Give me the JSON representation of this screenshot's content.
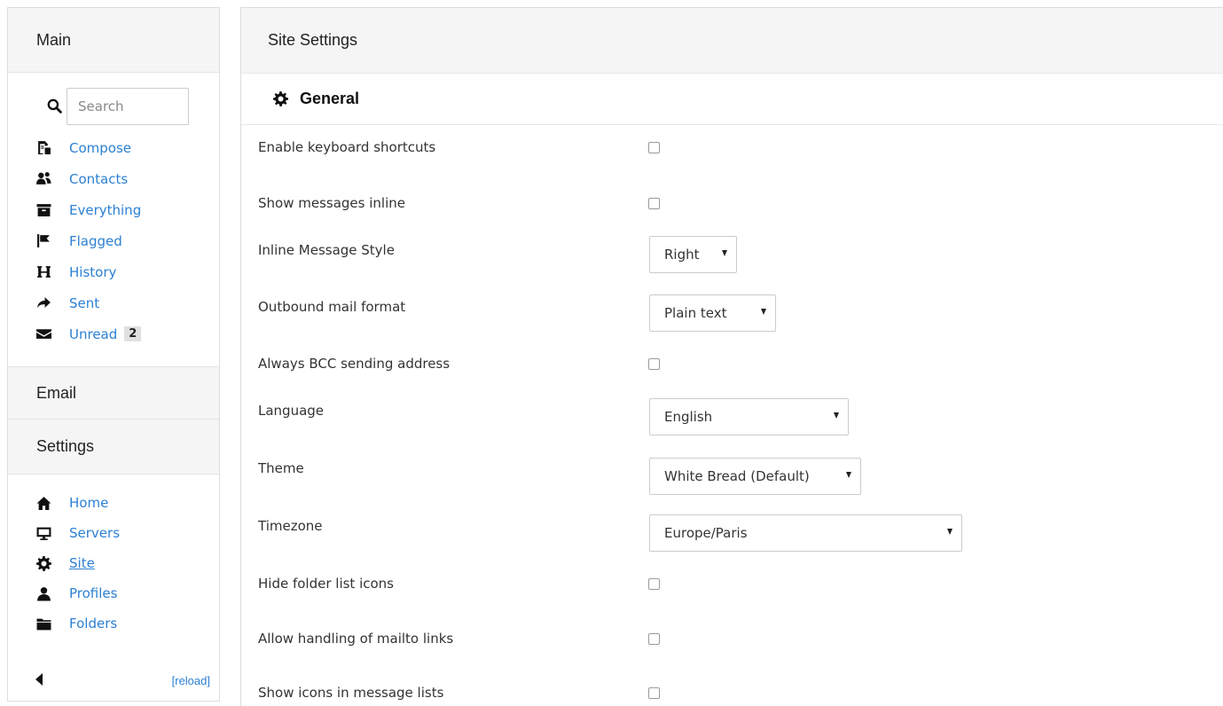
{
  "sidebar": {
    "main_title": "Main",
    "search": {
      "placeholder": "Search",
      "value": ""
    },
    "main_items": [
      {
        "label": "Compose",
        "icon": "compose-icon"
      },
      {
        "label": "Contacts",
        "icon": "contacts-icon"
      },
      {
        "label": "Everything",
        "icon": "inbox-icon"
      },
      {
        "label": "Flagged",
        "icon": "flag-icon"
      },
      {
        "label": "History",
        "icon": "history-icon"
      },
      {
        "label": "Sent",
        "icon": "share-arrow-icon"
      },
      {
        "label": "Unread",
        "icon": "envelope-icon",
        "badge": "2"
      }
    ],
    "email_title": "Email",
    "settings_title": "Settings",
    "settings_items": [
      {
        "label": "Home",
        "icon": "home-icon"
      },
      {
        "label": "Servers",
        "icon": "monitor-icon"
      },
      {
        "label": "Site",
        "icon": "gear-icon",
        "active": true
      },
      {
        "label": "Profiles",
        "icon": "person-icon"
      },
      {
        "label": "Folders",
        "icon": "folder-icon"
      }
    ],
    "reload_label": "[reload]"
  },
  "main": {
    "title": "Site Settings",
    "group_title": "General",
    "settings": [
      {
        "label": "Enable keyboard shortcuts",
        "type": "checkbox",
        "checked": false
      },
      {
        "label": "Show messages inline",
        "type": "checkbox",
        "checked": false
      },
      {
        "label": "Inline Message Style",
        "type": "select",
        "value": "Right"
      },
      {
        "label": "Outbound mail format",
        "type": "select",
        "value": "Plain text"
      },
      {
        "label": "Always BCC sending address",
        "type": "checkbox",
        "checked": false
      },
      {
        "label": "Language",
        "type": "select",
        "value": "English"
      },
      {
        "label": "Theme",
        "type": "select",
        "value": "White Bread (Default)"
      },
      {
        "label": "Timezone",
        "type": "select",
        "value": "Europe/Paris"
      },
      {
        "label": "Hide folder list icons",
        "type": "checkbox",
        "checked": false
      },
      {
        "label": "Allow handling of mailto links",
        "type": "checkbox",
        "checked": false
      },
      {
        "label": "Show icons in message lists",
        "type": "checkbox",
        "checked": false
      }
    ]
  },
  "colors": {
    "link": "#2c80d3",
    "header_bg": "#f5f5f5",
    "border": "#dddddd"
  }
}
